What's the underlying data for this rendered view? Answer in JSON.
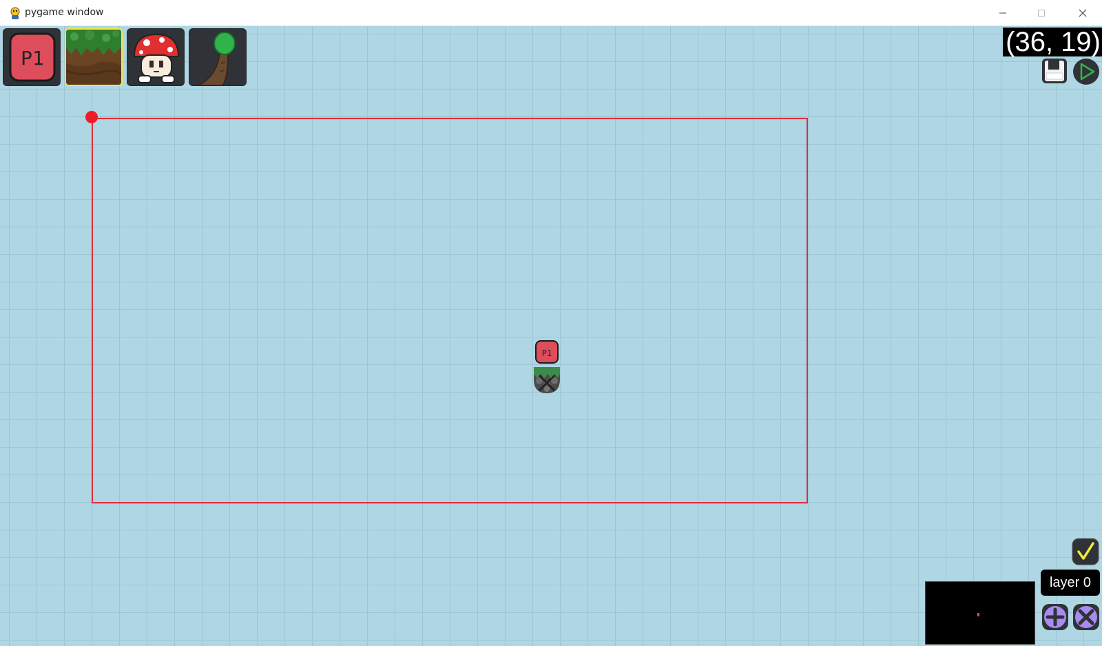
{
  "window": {
    "title": "pygame window",
    "controls": [
      "minimize-icon",
      "maximize-icon",
      "close-icon"
    ]
  },
  "toolbar": {
    "slots": [
      {
        "name": "player-spawn-tile",
        "icon": "player-marker-icon",
        "label": "P1",
        "selected": false
      },
      {
        "name": "grass-dirt-tile",
        "icon": "grass-dirt-icon",
        "selected": true
      },
      {
        "name": "mushroom-enemy-tile",
        "icon": "mushroom-character-icon",
        "selected": false
      },
      {
        "name": "tree-tile",
        "icon": "tree-icon",
        "selected": false
      }
    ]
  },
  "hud": {
    "cursor_coord": "(36, 19)",
    "save_icon": "floppy-disk-icon",
    "play_icon": "play-icon",
    "confirm_icon": "checkmark-icon",
    "layer_label": "layer 0",
    "add_icon": "plus-icon",
    "remove_icon": "x-icon"
  },
  "level": {
    "placed_objects": [
      {
        "name": "player-spawn",
        "label": "P1"
      },
      {
        "name": "grass-stone-block"
      }
    ]
  },
  "colors": {
    "background": "#aed6e3",
    "grid_line": "#9ec5d4",
    "bounds": "#e02b3a",
    "player_marker": "#dd4d5b",
    "selected_border": "#f2ea3a",
    "button_purple": "#a78bf0"
  }
}
